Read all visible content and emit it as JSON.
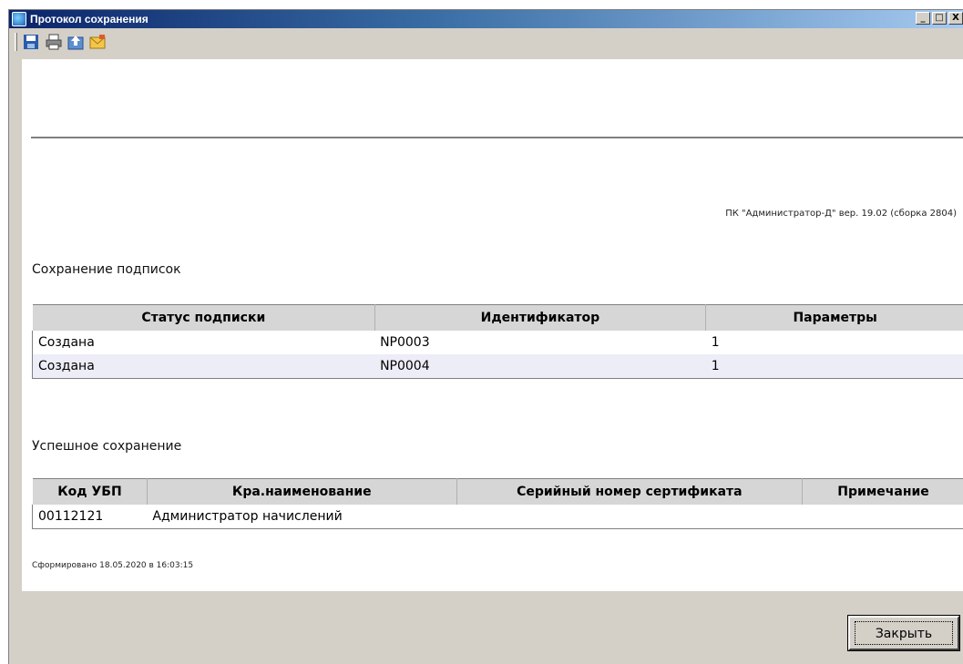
{
  "window": {
    "title": "Протокол сохранения",
    "controls": {
      "minimize": "_",
      "maximize": "□",
      "close": "X"
    }
  },
  "toolbar": {
    "buttons": [
      {
        "icon": "save-icon"
      },
      {
        "icon": "print-icon"
      },
      {
        "icon": "export-icon"
      },
      {
        "icon": "email-icon"
      }
    ]
  },
  "report": {
    "version": "ПК \"Администратор-Д\" вер. 19.02 (сборка 2804)",
    "subscriptions": {
      "title": "Сохранение подписок",
      "columns": [
        "Статус подписки",
        "Идентификатор",
        "Параметры"
      ],
      "rows": [
        [
          "Создана",
          "NP0003",
          "1"
        ],
        [
          "Создана",
          "NP0004",
          "1"
        ]
      ]
    },
    "success": {
      "title": "Успешное сохранение",
      "columns": [
        "Код УБП",
        "Кра.наименование",
        "Серийный номер сертификата",
        "Примечание"
      ],
      "rows": [
        [
          "00112121",
          "Администратор начислений",
          "",
          ""
        ]
      ]
    },
    "generated": "Сформировано 18.05.2020 в 16:03:15"
  },
  "footer": {
    "close_label": "Закрыть"
  },
  "colors": {
    "title_start": "#0a246a",
    "title_end": "#a6caf0",
    "face": "#d4d0c8",
    "alt_row": "#ededf8"
  }
}
